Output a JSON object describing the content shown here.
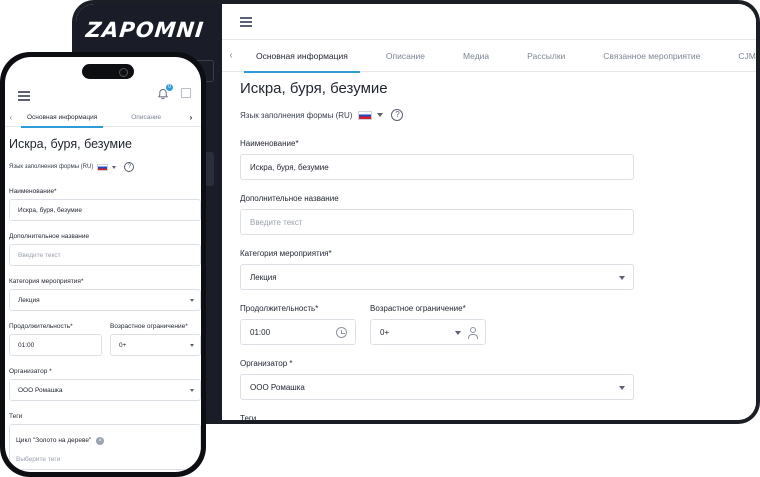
{
  "app": {
    "logo": "ZAPOMNI"
  },
  "tabs": [
    "Основная информация",
    "Описание",
    "Медиа",
    "Рассылки",
    "Связанное мероприятие",
    "CJM"
  ],
  "phone_tabs": [
    "Основная информация",
    "Описание"
  ],
  "notifications": {
    "count": "0"
  },
  "page": {
    "title": "Искра, буря, безумие",
    "language_label": "Язык заполнения формы (RU)",
    "help_symbol": "?"
  },
  "form": {
    "name": {
      "label": "Наименование*",
      "value": "Искра, буря, безумие"
    },
    "additional_name": {
      "label": "Дополнительное название",
      "placeholder": "Введите текст"
    },
    "category": {
      "label": "Категория мероприятия*",
      "value": "Лекция"
    },
    "duration": {
      "label": "Продолжительность*",
      "value": "01:00"
    },
    "age": {
      "label": "Возрастное ограничение*",
      "value": "0+"
    },
    "organizer": {
      "label": "Организатор *",
      "value": "ООО Ромашка"
    },
    "tags": {
      "label": "Теги",
      "chip": "Цикл \"Золото на дереве\"",
      "placeholder": "Выберите теги"
    }
  },
  "icons": {
    "menu": "hamburger-icon",
    "notification": "bell-icon",
    "avatar": "image-icon",
    "flag": "russia-flag-icon",
    "help": "help-circle-icon",
    "clock": "clock-icon",
    "person": "person-icon",
    "dropdown": "chevron-down-icon"
  },
  "colors": {
    "accent": "#2e9bd6",
    "sidebar": "#1a1d27",
    "text": "#1f2430",
    "muted": "#7d8596"
  }
}
